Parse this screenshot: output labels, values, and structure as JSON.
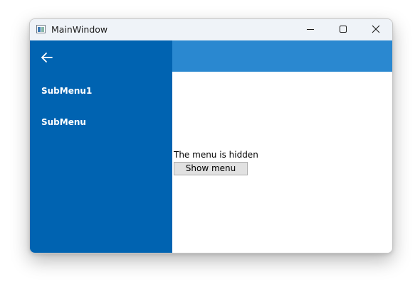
{
  "window": {
    "title": "MainWindow",
    "icon": "app-window-icon"
  },
  "caption_buttons": {
    "minimize_icon": "minimize-icon",
    "maximize_icon": "maximize-icon",
    "close_icon": "close-icon"
  },
  "sidebar": {
    "background": "#0063b1",
    "back_icon": "arrow-left-icon",
    "items": [
      {
        "label": "SubMenu1"
      },
      {
        "label": "SubMenu"
      }
    ]
  },
  "header": {
    "background": "#2a88d0"
  },
  "main": {
    "status_text": "The menu is hidden",
    "show_button_label": "Show menu"
  }
}
